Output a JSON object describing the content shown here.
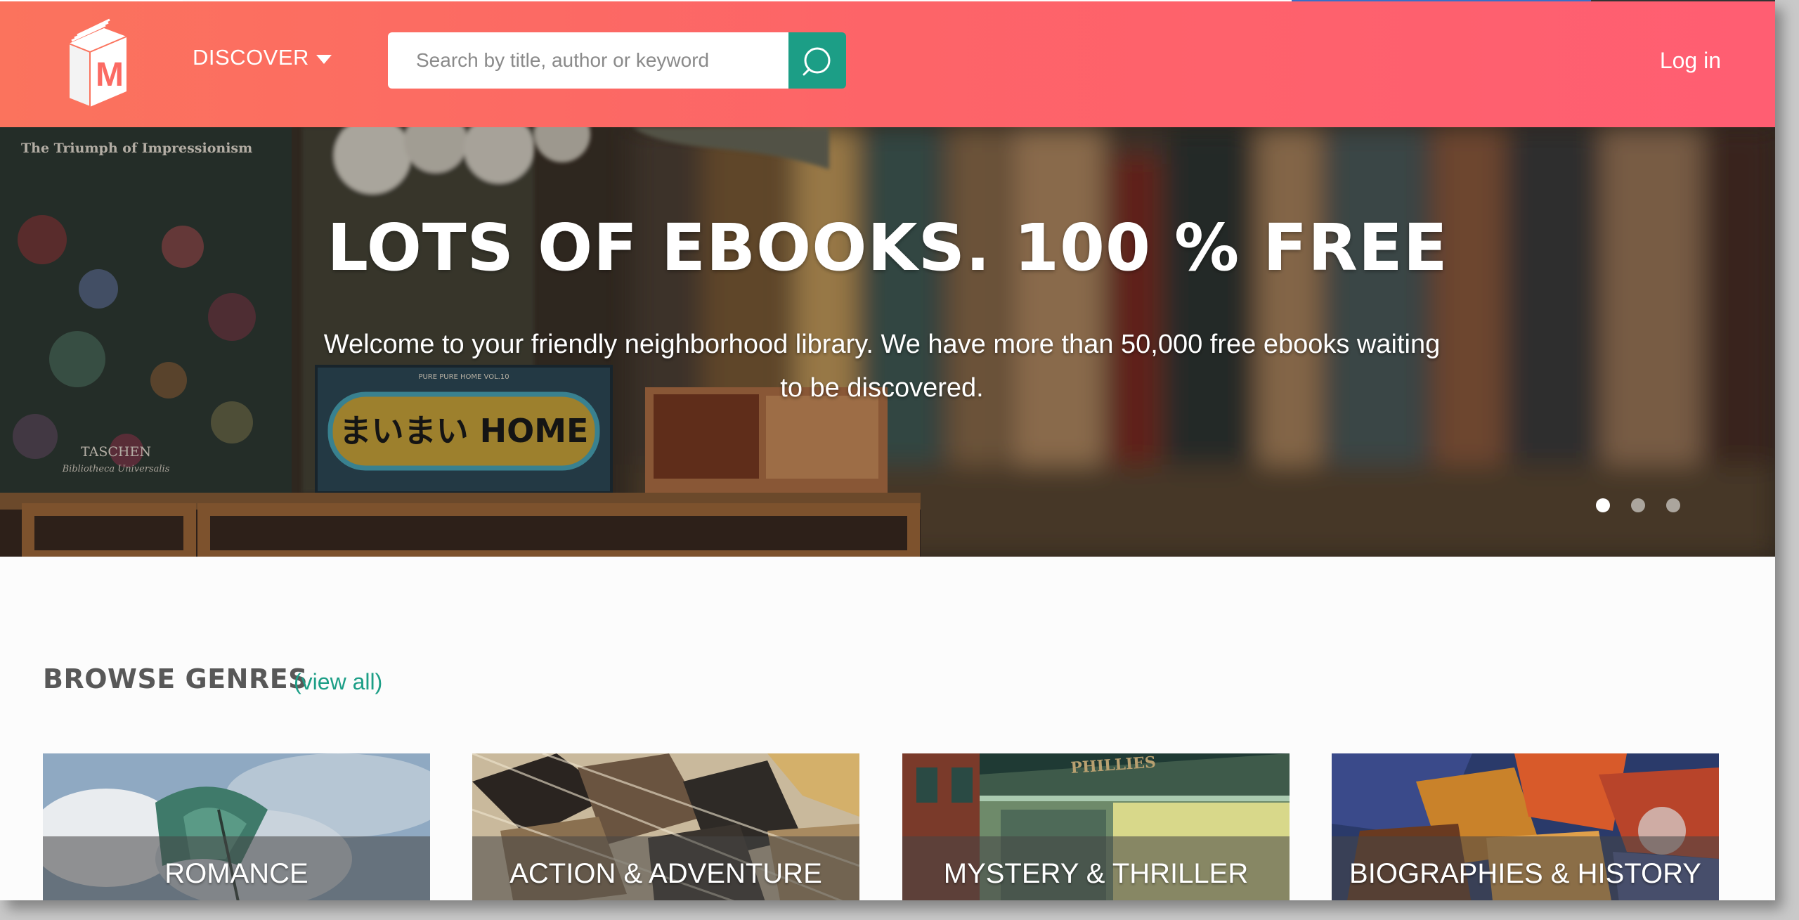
{
  "header": {
    "discover_label": "DISCOVER",
    "search_placeholder": "Search by title, author or keyword",
    "login_label": "Log in",
    "logo_letter": "M"
  },
  "hero": {
    "title": "LOTS OF EBOOKS. 100 % FREE",
    "subtitle": "Welcome to your friendly neighborhood library. We have more than 50,000 free ebooks waiting to be discovered.",
    "background_text": {
      "book_title": "The Triumph of Impressionism",
      "publisher": "TASCHEN",
      "series": "Bibliotheca Universalis",
      "sign": "まいまい HOME",
      "sign_sub": "PURE PURE HOME VOL.10"
    },
    "active_slide": 1,
    "slide_count": 3
  },
  "browse": {
    "title": "BROWSE GENRES",
    "view_all": "(view all)",
    "genres": [
      {
        "label": "ROMANCE"
      },
      {
        "label": "ACTION & ADVENTURE"
      },
      {
        "label": "MYSTERY & THRILLER",
        "image_text": "PHILLIES"
      },
      {
        "label": "BIOGRAPHIES & HISTORY"
      }
    ]
  },
  "colors": {
    "header_gradient_start": "#fb735d",
    "header_gradient_end": "#ff5e72",
    "accent": "#1c9e86",
    "heading": "#585858"
  }
}
